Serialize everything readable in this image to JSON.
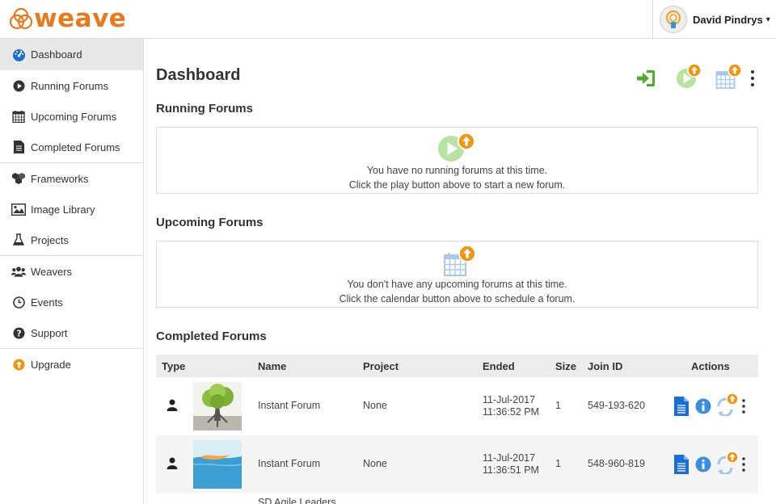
{
  "app": {
    "logo_text": "weave"
  },
  "user": {
    "name": "David Pindrys",
    "caret": "▾"
  },
  "sidebar": {
    "items": [
      {
        "label": "Dashboard",
        "icon": "dashboard-icon"
      },
      {
        "label": "Running Forums",
        "icon": "play-icon"
      },
      {
        "label": "Upcoming Forums",
        "icon": "calendar-icon"
      },
      {
        "label": "Completed Forums",
        "icon": "document-icon"
      },
      {
        "label": "Frameworks",
        "icon": "cubes-icon"
      },
      {
        "label": "Image Library",
        "icon": "image-icon"
      },
      {
        "label": "Projects",
        "icon": "flask-icon"
      },
      {
        "label": "Weavers",
        "icon": "users-icon"
      },
      {
        "label": "Events",
        "icon": "clock-icon"
      },
      {
        "label": "Support",
        "icon": "help-icon"
      },
      {
        "label": "Upgrade",
        "icon": "upgrade-icon"
      }
    ]
  },
  "main": {
    "title": "Dashboard",
    "running": {
      "title": "Running Forums",
      "line1": "You have no running forums at this time.",
      "line2": "Click the play button above to start a new forum."
    },
    "upcoming": {
      "title": "Upcoming Forums",
      "line1": "You don't have any upcoming forums at this time.",
      "line2": "Click the calendar button above to schedule a forum."
    },
    "completed": {
      "title": "Completed Forums",
      "columns": [
        "Type",
        "Name",
        "Project",
        "Ended",
        "Size",
        "Join ID",
        "Actions"
      ],
      "rows": [
        {
          "name": "Instant Forum",
          "project": "None",
          "ended_date": "11-Jul-2017",
          "ended_time": "11:36:52 PM",
          "size": "1",
          "join_id": "549-193-620"
        },
        {
          "name": "Instant Forum",
          "project": "None",
          "ended_date": "11-Jul-2017",
          "ended_time": "11:36:51 PM",
          "size": "1",
          "join_id": "548-960-819"
        },
        {
          "name": "SD Agile Leaders"
        }
      ]
    }
  },
  "colors": {
    "brand": "#e8791d",
    "accent_blue": "#1a6fd1",
    "green": "#5cb82a",
    "orange": "#f0960e"
  }
}
